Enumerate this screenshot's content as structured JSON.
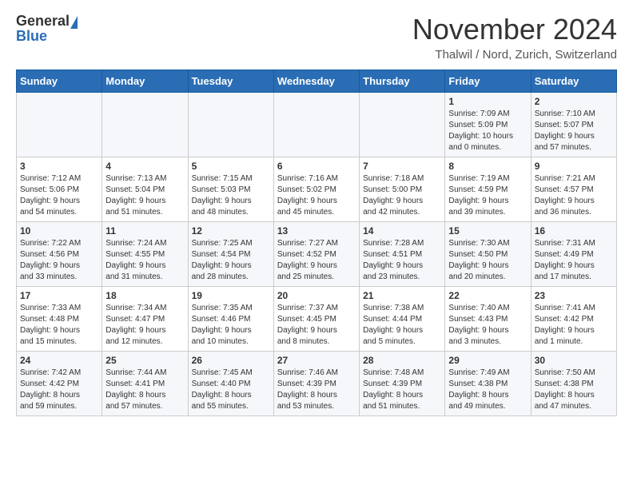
{
  "header": {
    "logo_general": "General",
    "logo_blue": "Blue",
    "month_title": "November 2024",
    "location": "Thalwil / Nord, Zurich, Switzerland"
  },
  "weekdays": [
    "Sunday",
    "Monday",
    "Tuesday",
    "Wednesday",
    "Thursday",
    "Friday",
    "Saturday"
  ],
  "weeks": [
    [
      {
        "day": "",
        "detail": ""
      },
      {
        "day": "",
        "detail": ""
      },
      {
        "day": "",
        "detail": ""
      },
      {
        "day": "",
        "detail": ""
      },
      {
        "day": "",
        "detail": ""
      },
      {
        "day": "1",
        "detail": "Sunrise: 7:09 AM\nSunset: 5:09 PM\nDaylight: 10 hours\nand 0 minutes."
      },
      {
        "day": "2",
        "detail": "Sunrise: 7:10 AM\nSunset: 5:07 PM\nDaylight: 9 hours\nand 57 minutes."
      }
    ],
    [
      {
        "day": "3",
        "detail": "Sunrise: 7:12 AM\nSunset: 5:06 PM\nDaylight: 9 hours\nand 54 minutes."
      },
      {
        "day": "4",
        "detail": "Sunrise: 7:13 AM\nSunset: 5:04 PM\nDaylight: 9 hours\nand 51 minutes."
      },
      {
        "day": "5",
        "detail": "Sunrise: 7:15 AM\nSunset: 5:03 PM\nDaylight: 9 hours\nand 48 minutes."
      },
      {
        "day": "6",
        "detail": "Sunrise: 7:16 AM\nSunset: 5:02 PM\nDaylight: 9 hours\nand 45 minutes."
      },
      {
        "day": "7",
        "detail": "Sunrise: 7:18 AM\nSunset: 5:00 PM\nDaylight: 9 hours\nand 42 minutes."
      },
      {
        "day": "8",
        "detail": "Sunrise: 7:19 AM\nSunset: 4:59 PM\nDaylight: 9 hours\nand 39 minutes."
      },
      {
        "day": "9",
        "detail": "Sunrise: 7:21 AM\nSunset: 4:57 PM\nDaylight: 9 hours\nand 36 minutes."
      }
    ],
    [
      {
        "day": "10",
        "detail": "Sunrise: 7:22 AM\nSunset: 4:56 PM\nDaylight: 9 hours\nand 33 minutes."
      },
      {
        "day": "11",
        "detail": "Sunrise: 7:24 AM\nSunset: 4:55 PM\nDaylight: 9 hours\nand 31 minutes."
      },
      {
        "day": "12",
        "detail": "Sunrise: 7:25 AM\nSunset: 4:54 PM\nDaylight: 9 hours\nand 28 minutes."
      },
      {
        "day": "13",
        "detail": "Sunrise: 7:27 AM\nSunset: 4:52 PM\nDaylight: 9 hours\nand 25 minutes."
      },
      {
        "day": "14",
        "detail": "Sunrise: 7:28 AM\nSunset: 4:51 PM\nDaylight: 9 hours\nand 23 minutes."
      },
      {
        "day": "15",
        "detail": "Sunrise: 7:30 AM\nSunset: 4:50 PM\nDaylight: 9 hours\nand 20 minutes."
      },
      {
        "day": "16",
        "detail": "Sunrise: 7:31 AM\nSunset: 4:49 PM\nDaylight: 9 hours\nand 17 minutes."
      }
    ],
    [
      {
        "day": "17",
        "detail": "Sunrise: 7:33 AM\nSunset: 4:48 PM\nDaylight: 9 hours\nand 15 minutes."
      },
      {
        "day": "18",
        "detail": "Sunrise: 7:34 AM\nSunset: 4:47 PM\nDaylight: 9 hours\nand 12 minutes."
      },
      {
        "day": "19",
        "detail": "Sunrise: 7:35 AM\nSunset: 4:46 PM\nDaylight: 9 hours\nand 10 minutes."
      },
      {
        "day": "20",
        "detail": "Sunrise: 7:37 AM\nSunset: 4:45 PM\nDaylight: 9 hours\nand 8 minutes."
      },
      {
        "day": "21",
        "detail": "Sunrise: 7:38 AM\nSunset: 4:44 PM\nDaylight: 9 hours\nand 5 minutes."
      },
      {
        "day": "22",
        "detail": "Sunrise: 7:40 AM\nSunset: 4:43 PM\nDaylight: 9 hours\nand 3 minutes."
      },
      {
        "day": "23",
        "detail": "Sunrise: 7:41 AM\nSunset: 4:42 PM\nDaylight: 9 hours\nand 1 minute."
      }
    ],
    [
      {
        "day": "24",
        "detail": "Sunrise: 7:42 AM\nSunset: 4:42 PM\nDaylight: 8 hours\nand 59 minutes."
      },
      {
        "day": "25",
        "detail": "Sunrise: 7:44 AM\nSunset: 4:41 PM\nDaylight: 8 hours\nand 57 minutes."
      },
      {
        "day": "26",
        "detail": "Sunrise: 7:45 AM\nSunset: 4:40 PM\nDaylight: 8 hours\nand 55 minutes."
      },
      {
        "day": "27",
        "detail": "Sunrise: 7:46 AM\nSunset: 4:39 PM\nDaylight: 8 hours\nand 53 minutes."
      },
      {
        "day": "28",
        "detail": "Sunrise: 7:48 AM\nSunset: 4:39 PM\nDaylight: 8 hours\nand 51 minutes."
      },
      {
        "day": "29",
        "detail": "Sunrise: 7:49 AM\nSunset: 4:38 PM\nDaylight: 8 hours\nand 49 minutes."
      },
      {
        "day": "30",
        "detail": "Sunrise: 7:50 AM\nSunset: 4:38 PM\nDaylight: 8 hours\nand 47 minutes."
      }
    ]
  ]
}
